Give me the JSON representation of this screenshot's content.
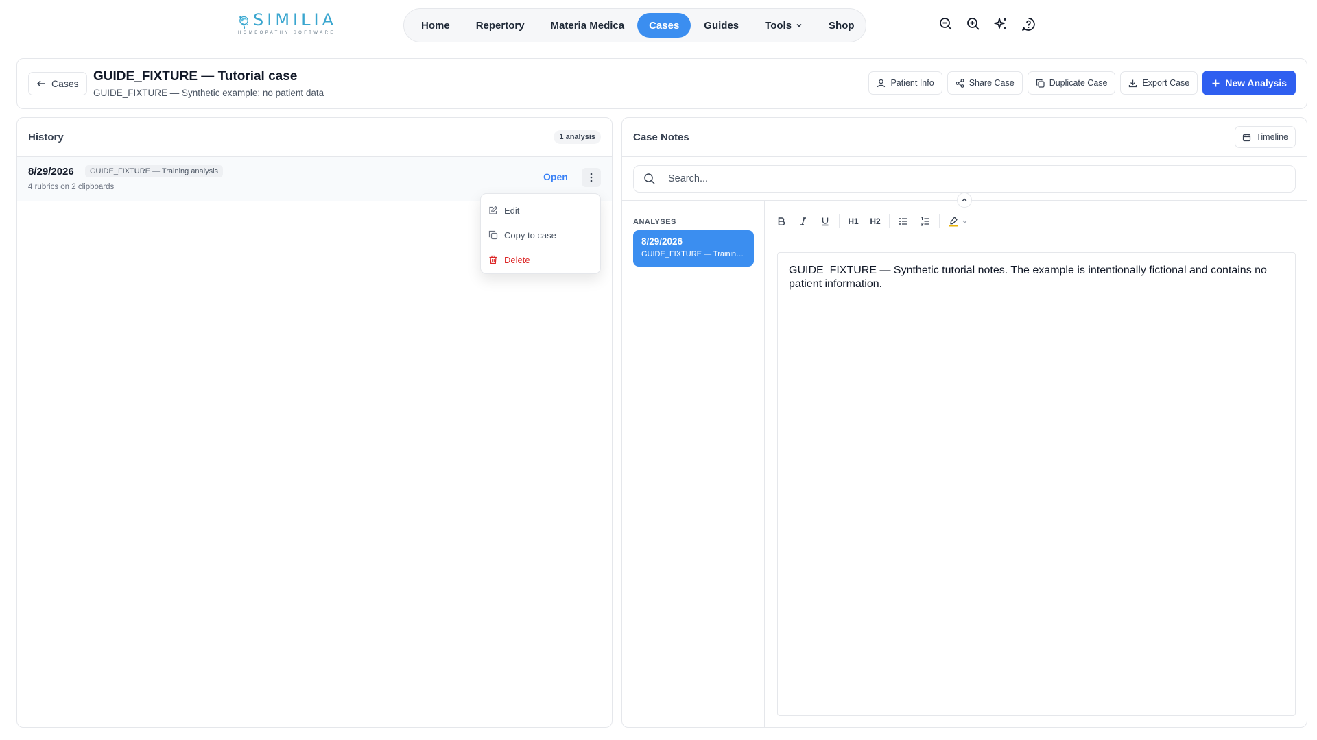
{
  "brand": {
    "name": "SIMILIA",
    "tagline": "HOMEOPATHY SOFTWARE",
    "color": "#3aa6cf"
  },
  "nav": {
    "items": [
      {
        "label": "Home",
        "active": false
      },
      {
        "label": "Repertory",
        "active": false
      },
      {
        "label": "Materia Medica",
        "active": false
      },
      {
        "label": "Cases",
        "active": true
      },
      {
        "label": "Guides",
        "active": false
      },
      {
        "label": "Tools",
        "active": false
      },
      {
        "label": "Shop",
        "active": false
      }
    ],
    "active_color": "#3b8ef0"
  },
  "top_icons": [
    "zoom-out-icon",
    "zoom-in-icon",
    "sparkles-icon",
    "help-icon"
  ],
  "header": {
    "back_label": "Cases",
    "title": "GUIDE_FIXTURE — Tutorial case",
    "subtitle": "GUIDE_FIXTURE — Synthetic example; no patient data",
    "actions": {
      "patient_info": "Patient Info",
      "share_case": "Share Case",
      "duplicate_case": "Duplicate Case",
      "export_case": "Export Case",
      "new_analysis": "New Analysis"
    },
    "primary_color": "#2f5ff0"
  },
  "history": {
    "title": "History",
    "count_badge": "1 analysis",
    "rows": [
      {
        "date": "8/29/2026",
        "tag": "GUIDE_FIXTURE — Training analysis",
        "meta": "4 rubrics on 2 clipboards",
        "open_label": "Open"
      }
    ],
    "menu": {
      "edit": "Edit",
      "copy": "Copy to case",
      "delete": "Delete"
    },
    "danger_color": "#dc2626"
  },
  "notes": {
    "title": "Case Notes",
    "timeline_label": "Timeline",
    "search_placeholder": "Search...",
    "analyses_label": "ANALYSES",
    "analyses": [
      {
        "date": "8/29/2026",
        "name": "GUIDE_FIXTURE — Training analysis"
      }
    ],
    "toolbar": {
      "h1": "H1",
      "h2": "H2"
    },
    "body": "GUIDE_FIXTURE — Synthetic tutorial notes. The example is intentionally fictional and contains no patient information."
  }
}
